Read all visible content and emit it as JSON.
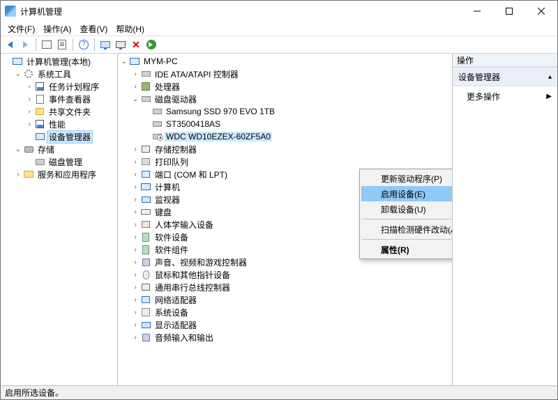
{
  "titlebar": {
    "title": "计算机管理"
  },
  "menubar": {
    "file": "文件(F)",
    "action": "操作(A)",
    "view": "查看(V)",
    "help": "帮助(H)"
  },
  "left_tree": {
    "root": "计算机管理(本地)",
    "system_tools": "系统工具",
    "task_scheduler": "任务计划程序",
    "event_viewer": "事件查看器",
    "shared_folders": "共享文件夹",
    "performance": "性能",
    "device_manager": "设备管理器",
    "storage": "存储",
    "disk_management": "磁盘管理",
    "services_apps": "服务和应用程序"
  },
  "center_tree": {
    "root": "MYM-PC",
    "ide": "IDE ATA/ATAPI 控制器",
    "cpu": "处理器",
    "disk_drives": "磁盘驱动器",
    "disk1": "Samsung SSD 970 EVO 1TB",
    "disk2": "ST3500418AS",
    "disk3": "WDC WD10EZEX-60ZF5A0",
    "storage_ctrl": "存储控制器",
    "print_queues": "打印队列",
    "ports": "端口 (COM 和 LPT)",
    "computer": "计算机",
    "monitors": "监视器",
    "keyboards": "键盘",
    "hid": "人体学输入设备",
    "sw_devices": "软件设备",
    "sw_components": "软件组件",
    "sound": "声音、视频和游戏控制器",
    "mouse": "鼠标和其他指针设备",
    "usb": "通用串行总线控制器",
    "network": "网络适配器",
    "system_devices": "系统设备",
    "display": "显示适配器",
    "audio_io": "音频输入和输出"
  },
  "contextmenu": {
    "update_driver": "更新驱动程序(P)",
    "enable_device": "启用设备(E)",
    "uninstall_device": "卸载设备(U)",
    "scan_hardware": "扫描检测硬件改动(A)",
    "properties": "属性(R)"
  },
  "actions": {
    "header": "操作",
    "section": "设备管理器",
    "more": "更多操作"
  },
  "statusbar": {
    "text": "启用所选设备。"
  }
}
